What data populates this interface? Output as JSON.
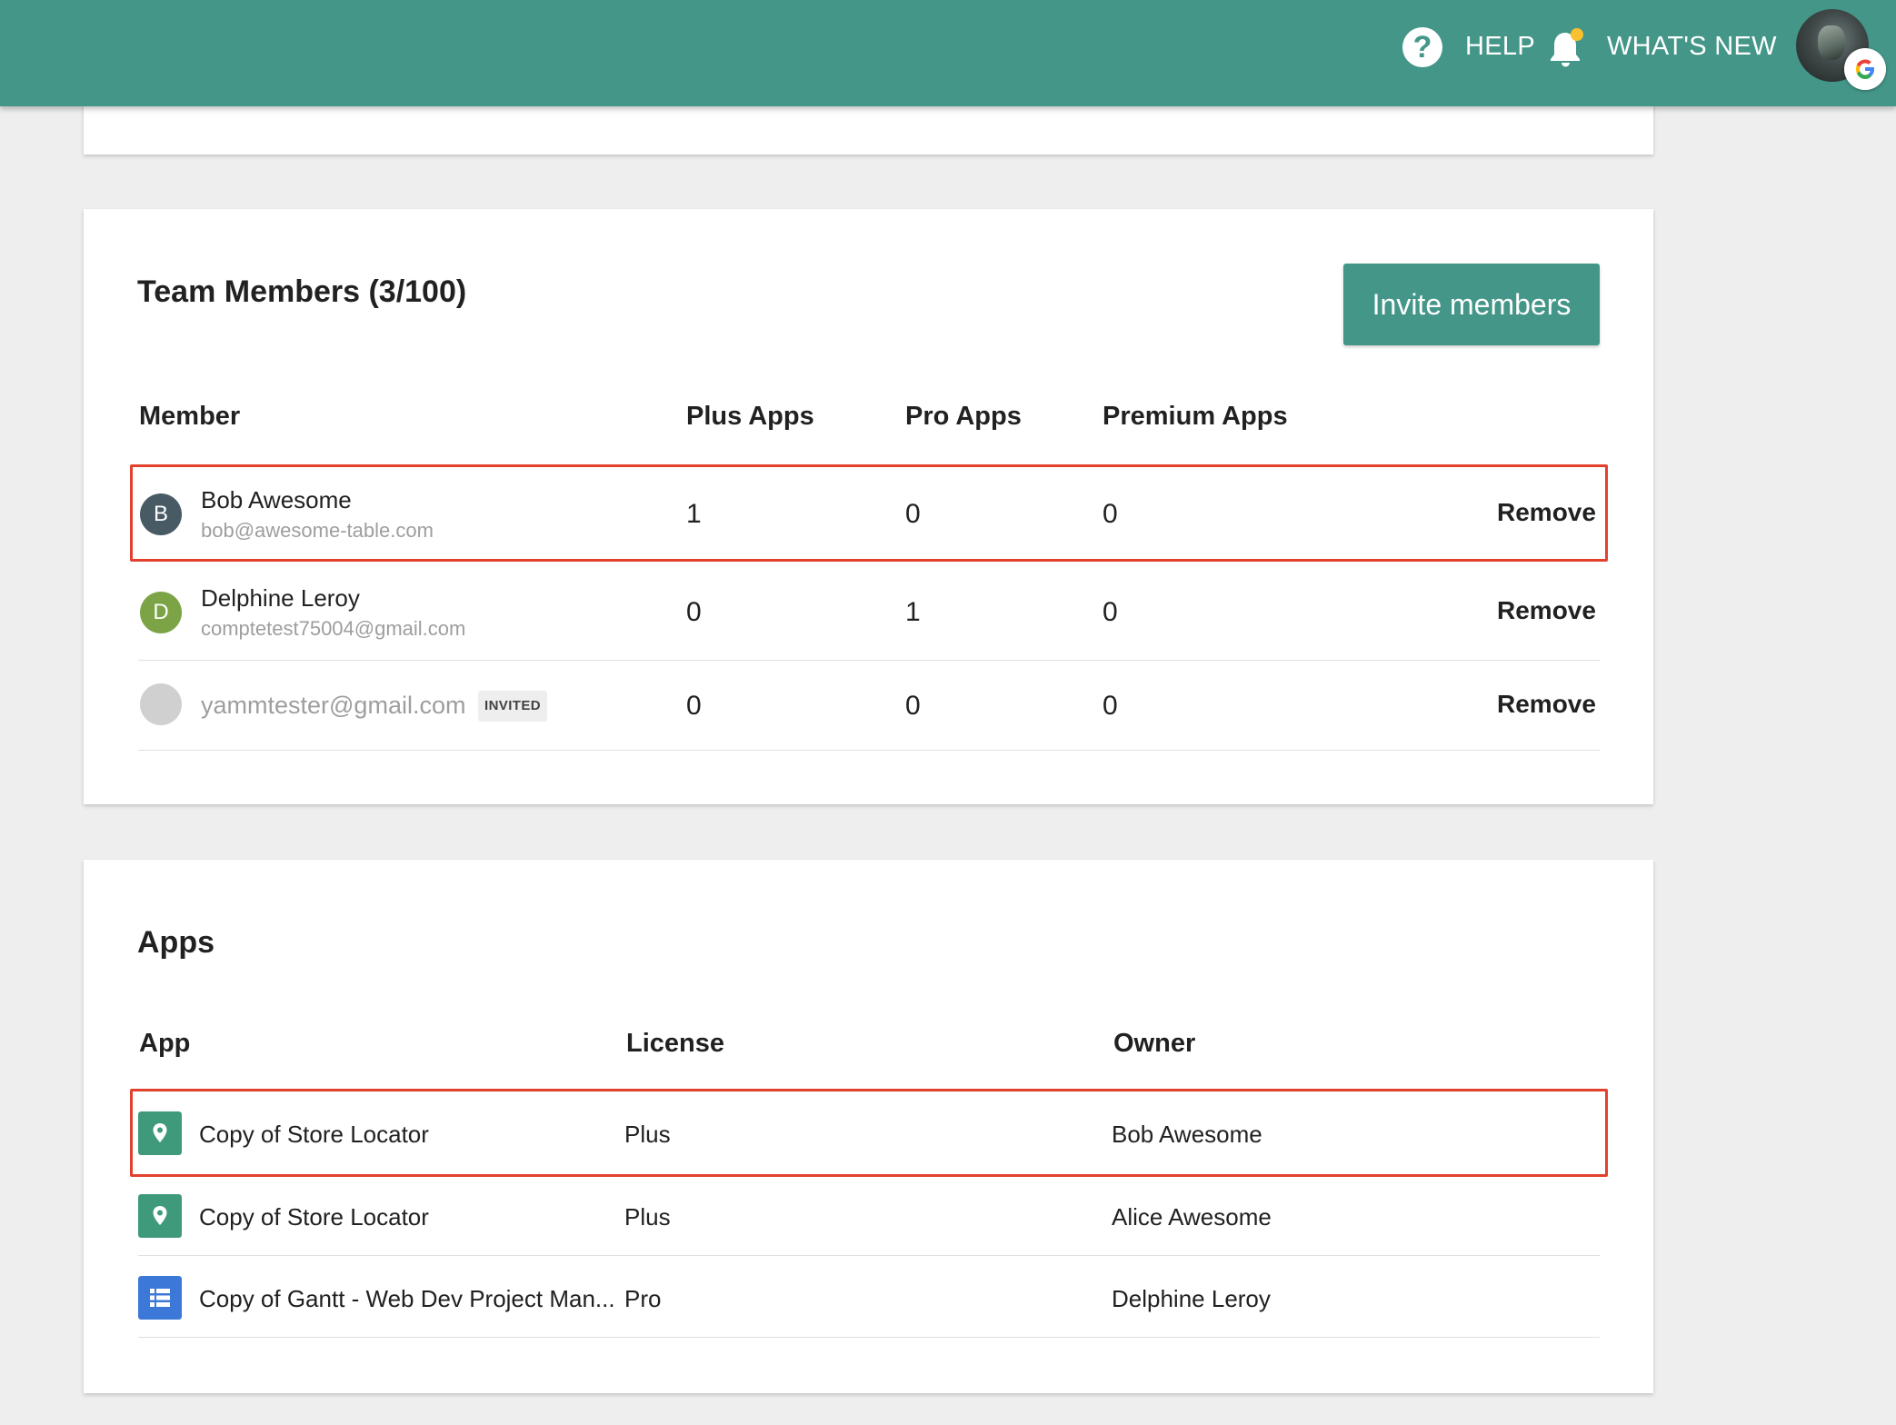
{
  "topbar": {
    "help_label": "HELP",
    "whats_new_label": "WHAT'S NEW",
    "notification_dot_color": "#fbc02d",
    "bar_color": "#439688"
  },
  "team": {
    "title": "Team Members (3/100)",
    "invite_label": "Invite members",
    "columns": [
      "Member",
      "Plus Apps",
      "Pro Apps",
      "Premium Apps"
    ],
    "rows": [
      {
        "initial": "B",
        "avatar_color": "#485a64",
        "name": "Bob Awesome",
        "email": "bob@awesome-table.com",
        "plus": "1",
        "pro": "0",
        "premium": "0",
        "action": "Remove",
        "highlighted": true
      },
      {
        "initial": "D",
        "avatar_color": "#7ca447",
        "name": "Delphine Leroy",
        "email": "comptetest75004@gmail.com",
        "plus": "0",
        "pro": "1",
        "premium": "0",
        "action": "Remove",
        "highlighted": false
      },
      {
        "initial": "",
        "avatar_color": "#d0d0d0",
        "email": "yammtester@gmail.com",
        "badge": "INVITED",
        "plus": "0",
        "pro": "0",
        "premium": "0",
        "action": "Remove",
        "highlighted": false
      }
    ]
  },
  "apps": {
    "title": "Apps",
    "columns": [
      "App",
      "License",
      "Owner"
    ],
    "rows": [
      {
        "icon": "map-pin-icon",
        "icon_color": "#3f9a7c",
        "name": "Copy of Store Locator",
        "license": "Plus",
        "owner": "Bob Awesome",
        "highlighted": true
      },
      {
        "icon": "map-pin-icon",
        "icon_color": "#3f9a7c",
        "name": "Copy of Store Locator",
        "license": "Plus",
        "owner": "Alice Awesome",
        "highlighted": false
      },
      {
        "icon": "list-icon",
        "icon_color": "#3c78d8",
        "name": "Copy of Gantt - Web Dev Project Man...",
        "license": "Pro",
        "owner": "Delphine Leroy",
        "highlighted": false
      }
    ]
  },
  "highlight_color": "#e2412d"
}
